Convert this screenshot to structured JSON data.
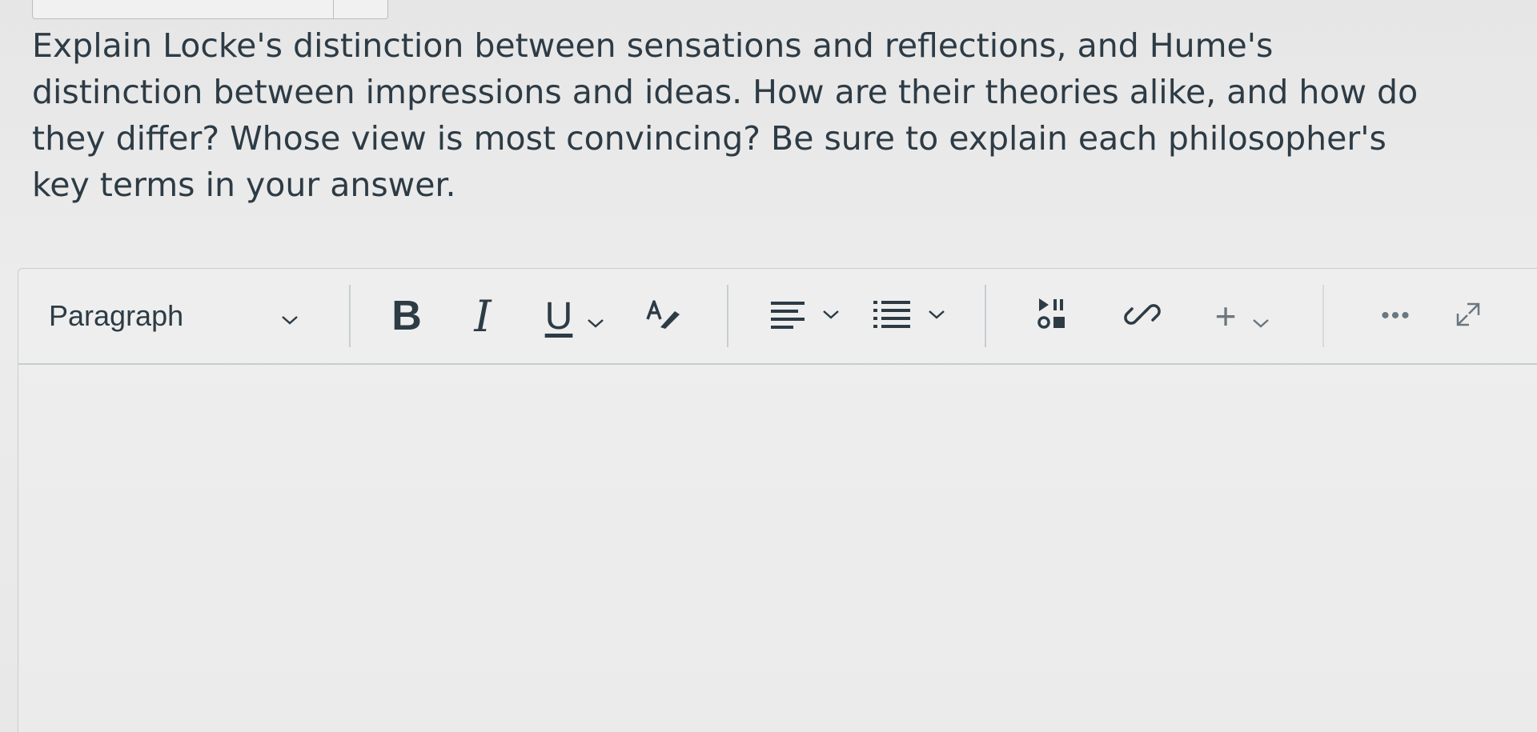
{
  "question": {
    "lines": [
      "Explain Locke's distinction between sensations and reflections, and Hume's",
      "distinction between impressions and ideas. How are their theories alike, and how do",
      "they differ? Whose view is most convincing? Be sure to explain each philosopher's",
      "key terms in your answer."
    ]
  },
  "toolbar": {
    "block_format": "Paragraph",
    "bold_label": "B",
    "italic_label": "I",
    "underline_label": "U",
    "insert_label": "+",
    "more_label": "•••"
  },
  "editor": {
    "content": ""
  },
  "colors": {
    "text": "#2d3b45",
    "border": "#c7cdd1",
    "muted_icon": "#6b7780"
  }
}
